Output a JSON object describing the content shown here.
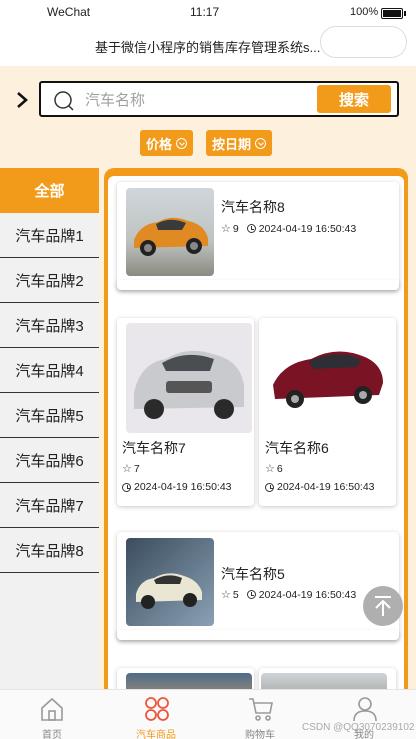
{
  "status_bar": {
    "carrier": "WeChat",
    "time": "11:17",
    "battery": "100%"
  },
  "nav": {
    "title": "基于微信小程序的销售库存管理系统s..."
  },
  "search": {
    "placeholder": "汽车名称",
    "button": "搜索"
  },
  "sort": {
    "price": "价格",
    "date": "按日期"
  },
  "sidebar": {
    "items": [
      {
        "label": "全部",
        "active": true
      },
      {
        "label": "汽车品牌1"
      },
      {
        "label": "汽车品牌2"
      },
      {
        "label": "汽车品牌3"
      },
      {
        "label": "汽车品牌4"
      },
      {
        "label": "汽车品牌5"
      },
      {
        "label": "汽车品牌6"
      },
      {
        "label": "汽车品牌7"
      },
      {
        "label": "汽车品牌8"
      }
    ]
  },
  "products": [
    {
      "name": "汽车名称8",
      "stars": "9",
      "date": "2024-04-19 16:50:43"
    },
    {
      "name": "汽车名称7",
      "stars": "7",
      "date": "2024-04-19 16:50:43"
    },
    {
      "name": "汽车名称6",
      "stars": "6",
      "date": "2024-04-19 16:50:43"
    },
    {
      "name": "汽车名称5",
      "stars": "5",
      "date": "2024-04-19 16:50:43"
    }
  ],
  "tabbar": [
    {
      "label": "首页",
      "icon": "home-icon"
    },
    {
      "label": "汽车商品",
      "icon": "products-icon",
      "active": true
    },
    {
      "label": "购物车",
      "icon": "cart-icon"
    },
    {
      "label": "我的",
      "icon": "user-icon"
    }
  ],
  "watermark": "CSDN @QQ3070239102",
  "colors": {
    "accent": "#f29a1a",
    "background": "#fdf1de"
  }
}
